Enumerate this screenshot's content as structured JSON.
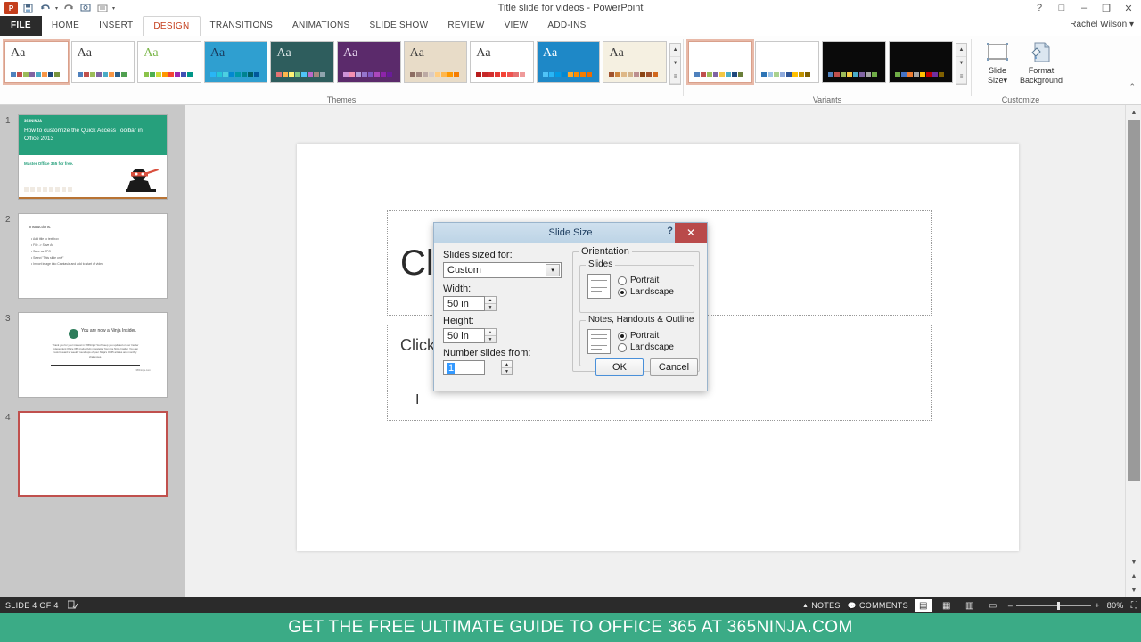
{
  "window": {
    "title": "Title slide for videos - PowerPoint",
    "user": "Rachel Wilson",
    "help_btn": "?",
    "ribbon_display_btn": "□",
    "minimize_btn": "–",
    "restore_btn": "❐",
    "close_btn": "✕",
    "user_caret": "▾"
  },
  "qat": {
    "app_logo": "P",
    "items": [
      "save-icon",
      "undo-icon",
      "redo-icon",
      "start-slideshow-icon",
      "presenter-view-icon",
      "customize-qat-icon"
    ],
    "undo_caret": "▾",
    "more_caret": "▾"
  },
  "tabs": [
    {
      "label": "FILE",
      "active": false,
      "file": true
    },
    {
      "label": "HOME",
      "active": false
    },
    {
      "label": "INSERT",
      "active": false
    },
    {
      "label": "DESIGN",
      "active": true
    },
    {
      "label": "TRANSITIONS",
      "active": false
    },
    {
      "label": "ANIMATIONS",
      "active": false
    },
    {
      "label": "SLIDE SHOW",
      "active": false
    },
    {
      "label": "REVIEW",
      "active": false
    },
    {
      "label": "VIEW",
      "active": false
    },
    {
      "label": "ADD-INS",
      "active": false
    }
  ],
  "ribbon": {
    "themes_group_label": "Themes",
    "variants_group_label": "Variants",
    "customize_group_label": "Customize",
    "collapse_caret": "⌃",
    "aa_text": "Aa",
    "scroll_up": "▲",
    "scroll_down": "▼",
    "scroll_more": "≡",
    "themes": [
      {
        "name": "office-theme",
        "selected": true,
        "bg": "#ffffff",
        "aa_color": "#3c3c3c",
        "swatches": [
          "#4f81bd",
          "#c0504d",
          "#9bbb59",
          "#8064a2",
          "#4bacc6",
          "#f79646",
          "#1f497d",
          "#77933c"
        ]
      },
      {
        "name": "facet-theme",
        "selected": false,
        "bg": "#ffffff",
        "aa_color": "#3c3c3c",
        "swatches": [
          "#4f81bd",
          "#c0504d",
          "#9bbb59",
          "#8064a2",
          "#4bacc6",
          "#f79646",
          "#2c5f8a",
          "#50a050"
        ]
      },
      {
        "name": "ion-theme",
        "selected": false,
        "bg": "#ffffff",
        "aa_color": "#7ab648",
        "swatches": [
          "#8bc34a",
          "#4caf50",
          "#cddc39",
          "#ff9800",
          "#f44336",
          "#9c27b0",
          "#3f51b5",
          "#009688"
        ]
      },
      {
        "name": "retrospect-theme",
        "selected": false,
        "bg": "#2f9fd0",
        "aa_color": "#1a3a5c",
        "swatches": [
          "#29b6f6",
          "#26c6da",
          "#4dd0e1",
          "#0288d1",
          "#0097a7",
          "#00838f",
          "#006064",
          "#01579b"
        ]
      },
      {
        "name": "slice-theme",
        "selected": false,
        "bg": "#2e5d5d",
        "aa_color": "#dfe8e8",
        "swatches": [
          "#e57373",
          "#ffb74d",
          "#fff176",
          "#81c784",
          "#4fc3f7",
          "#ba68c8",
          "#a1887f",
          "#90a4ae"
        ]
      },
      {
        "name": "wisp-theme",
        "selected": false,
        "bg": "#5b2a6b",
        "aa_color": "#e8d8f0",
        "swatches": [
          "#ce93d8",
          "#f48fb1",
          "#b39ddb",
          "#9575cd",
          "#7e57c2",
          "#ab47bc",
          "#8e24aa",
          "#6a1b9a"
        ]
      },
      {
        "name": "berlin-theme",
        "selected": false,
        "bg": "#e8dcc8",
        "aa_color": "#3c3c3c",
        "swatches": [
          "#8d6e63",
          "#a1887f",
          "#bcaaa4",
          "#d7ccc8",
          "#ffcc80",
          "#ffb74d",
          "#ff9800",
          "#f57c00"
        ]
      },
      {
        "name": "celestial-theme",
        "selected": false,
        "bg": "#ffffff",
        "aa_color": "#3c3c3c",
        "swatches": [
          "#b71c1c",
          "#c62828",
          "#d32f2f",
          "#e53935",
          "#f44336",
          "#ef5350",
          "#e57373",
          "#ef9a9a"
        ]
      },
      {
        "name": "depth-theme",
        "selected": false,
        "bg": "#1e88c7",
        "aa_color": "#ffffff",
        "swatches": [
          "#4fc3f7",
          "#29b6f6",
          "#039be5",
          "#0288d1",
          "#ffa726",
          "#fb8c00",
          "#f57c00",
          "#ef6c00"
        ]
      },
      {
        "name": "quotable-theme",
        "selected": false,
        "bg": "#f5f0e1",
        "aa_color": "#3c3c3c",
        "swatches": [
          "#a0522d",
          "#cd853f",
          "#deb887",
          "#d2b48c",
          "#bc8f8f",
          "#8b4513",
          "#a0522d",
          "#d2691e"
        ]
      }
    ],
    "variants": [
      {
        "name": "variant-1",
        "selected": true,
        "bg": "#ffffff",
        "swatches": [
          "#4f81bd",
          "#c0504d",
          "#9bbb59",
          "#8064a2",
          "#f2c744",
          "#4bacc6",
          "#1f497d",
          "#6a7f3a"
        ]
      },
      {
        "name": "variant-2",
        "selected": false,
        "bg": "#ffffff",
        "swatches": [
          "#2e75b6",
          "#9dc3e6",
          "#a9d18e",
          "#8faadc",
          "#2f5597",
          "#ffc000",
          "#bf9000",
          "#7f6000"
        ]
      },
      {
        "name": "variant-3",
        "selected": false,
        "bg": "#0a0a0a",
        "swatches": [
          "#4f81bd",
          "#c0504d",
          "#9bbb59",
          "#f2c744",
          "#4bacc6",
          "#8064a2",
          "#a5a5a5",
          "#70ad47"
        ]
      },
      {
        "name": "variant-4",
        "selected": false,
        "bg": "#0a0a0a",
        "swatches": [
          "#70ad47",
          "#4472c4",
          "#ed7d31",
          "#a5a5a5",
          "#ffc000",
          "#c00000",
          "#7030a0",
          "#806000"
        ]
      }
    ],
    "slide_size_label_1": "Slide",
    "slide_size_label_2": "Size",
    "slide_size_caret": "▾",
    "format_bg_label_1": "Format",
    "format_bg_label_2": "Background"
  },
  "slides": [
    {
      "number": "1",
      "current": false,
      "type": "title",
      "logo": "365NINJA",
      "title": "How to customize the Quick Access Toolbar in Office 2013",
      "subtitle": "Master Office 365 for free."
    },
    {
      "number": "2",
      "current": false,
      "type": "bullets",
      "heading": "Instructions:",
      "bullets": [
        "Add title to text box",
        "File -> Save As",
        "Save as JPG",
        "Select \"This slide only\"",
        "Import image into Camtasia and add to start of video"
      ]
    },
    {
      "number": "3",
      "current": false,
      "type": "message",
      "headline": "You are now a Ninja Insider.",
      "body": "Thank you for your interest in 365Ninja! You'll keep you updated on our Insider independent Office 365 productivity newsletter from the Ninja Insider. You can look forward to weekly round-ups of your Ninja's O365 articles and monthly challenges.",
      "signature": "365ninja.com"
    },
    {
      "number": "4",
      "current": true,
      "type": "blank"
    }
  ],
  "editor": {
    "title_placeholder": "Click to add title",
    "subtitle_placeholder": "Click to add subtitle",
    "cursor_glyph": "I"
  },
  "dialog": {
    "title": "Slide Size",
    "help_glyph": "?",
    "close_glyph": "✕",
    "sized_for_label": "Slides sized for:",
    "sized_for_value": "Custom",
    "sized_for_caret": "▾",
    "width_label": "Width:",
    "width_value": "50 in",
    "height_label": "Height:",
    "height_value": "50 in",
    "number_from_label": "Number slides from:",
    "number_from_value": "1",
    "spin_up": "▲",
    "spin_down": "▼",
    "orientation_legend": "Orientation",
    "slides_legend": "Slides",
    "notes_legend": "Notes, Handouts & Outline",
    "slides_portrait": "Portrait",
    "slides_landscape": "Landscape",
    "slides_selected": "Landscape",
    "notes_portrait": "Portrait",
    "notes_landscape": "Landscape",
    "notes_selected": "Portrait",
    "ok_label": "OK",
    "cancel_label": "Cancel"
  },
  "statusbar": {
    "slide_counter": "SLIDE 4 OF 4",
    "language_icon": "spell-check-icon",
    "notes_label": "NOTES",
    "notes_icon": "▲",
    "comments_label": "COMMENTS",
    "comments_icon": "▬",
    "view_normal": "▤",
    "view_sorter": "▦",
    "view_reading": "▥",
    "view_slideshow": "▭",
    "zoom_out": "–",
    "zoom_in": "+",
    "zoom_level": "80%",
    "fit_icon": "⛶"
  },
  "banner": {
    "text": "GET THE FREE ULTIMATE GUIDE TO OFFICE 365 AT 365NINJA.COM",
    "bg": "#3bab86"
  },
  "colors": {
    "accent": "#c43e1c",
    "dialog_close": "#b94a4a",
    "selection_border": "#c0504d",
    "banner_green": "#3bab86",
    "status_dark": "#2b2b2b"
  }
}
